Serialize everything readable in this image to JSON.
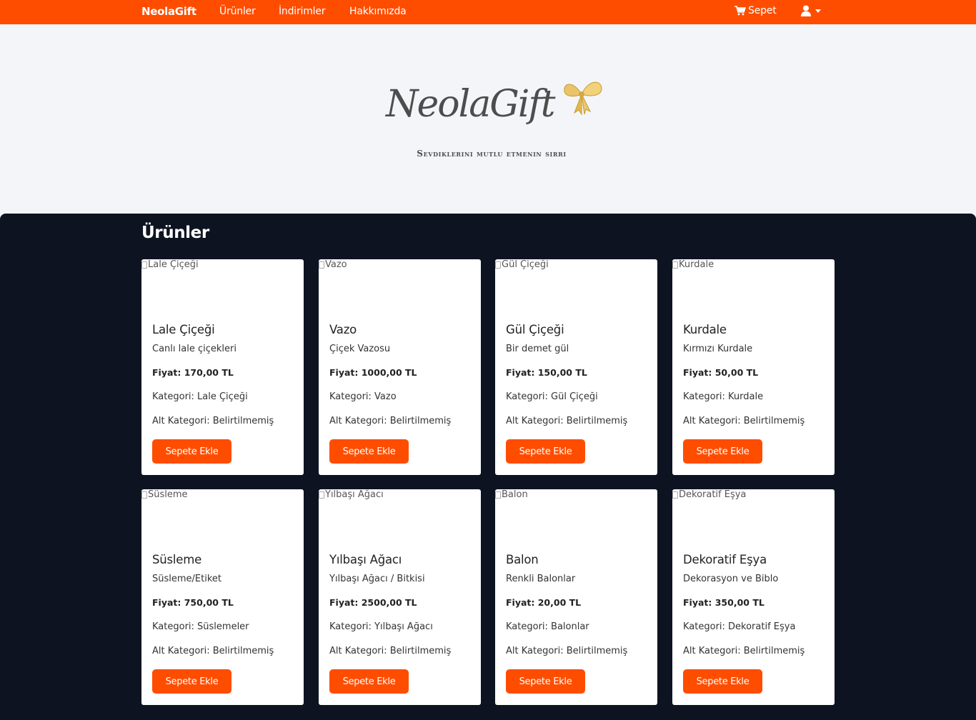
{
  "colors": {
    "brand": "#ff4d00",
    "panel": "#0e1321",
    "hero": "#f4f5f8"
  },
  "navbar": {
    "brand": "NeolaGift",
    "links": [
      "Ürünler",
      "İndirimler",
      "Hakkımızda"
    ],
    "cart_label": "Sepet",
    "cart_icon": "shopping-cart-icon",
    "user_icon": "user-icon"
  },
  "hero": {
    "logo_script": "NeolaGift",
    "tagline": "Sevdiklerini mutlu etmenin sırrı"
  },
  "products_section": {
    "title": "Ürünler",
    "add_to_cart_label": "Sepete Ekle",
    "items": [
      {
        "name": "Lale Çiçeği",
        "image_alt": "Lale Çiçeği",
        "description": "Canlı lale çiçekleri",
        "price_label": "Fiyat: 170,00 TL",
        "category_label": "Kategori: Lale Çiçeği",
        "subcategory_label": "Alt Kategori: Belirtilmemiş"
      },
      {
        "name": "Vazo",
        "image_alt": "Vazo",
        "description": "Çiçek Vazosu",
        "price_label": "Fiyat: 1000,00 TL",
        "category_label": "Kategori: Vazo",
        "subcategory_label": "Alt Kategori: Belirtilmemiş"
      },
      {
        "name": "Gül Çiçeği",
        "image_alt": "Gül Çiçeği",
        "description": "Bir demet gül",
        "price_label": "Fiyat: 150,00 TL",
        "category_label": "Kategori: Gül Çiçeği",
        "subcategory_label": "Alt Kategori: Belirtilmemiş"
      },
      {
        "name": "Kurdale",
        "image_alt": "Kurdale",
        "description": "Kırmızı Kurdale",
        "price_label": "Fiyat: 50,00 TL",
        "category_label": "Kategori: Kurdale",
        "subcategory_label": "Alt Kategori: Belirtilmemiş"
      },
      {
        "name": "Süsleme",
        "image_alt": "Süsleme",
        "description": "Süsleme/Etiket",
        "price_label": "Fiyat: 750,00 TL",
        "category_label": "Kategori: Süslemeler",
        "subcategory_label": "Alt Kategori: Belirtilmemiş"
      },
      {
        "name": "Yılbaşı Ağacı",
        "image_alt": "Yılbaşı Ağacı",
        "description": "Yılbaşı Ağacı / Bitkisi",
        "price_label": "Fiyat: 2500,00 TL",
        "category_label": "Kategori: Yılbaşı Ağacı",
        "subcategory_label": "Alt Kategori: Belirtilmemiş"
      },
      {
        "name": "Balon",
        "image_alt": "Balon",
        "description": "Renkli Balonlar",
        "price_label": "Fiyat: 20,00 TL",
        "category_label": "Kategori: Balonlar",
        "subcategory_label": "Alt Kategori: Belirtilmemiş"
      },
      {
        "name": "Dekoratif Eşya",
        "image_alt": "Dekoratif Eşya",
        "description": "Dekorasyon ve Biblo",
        "price_label": "Fiyat: 350,00 TL",
        "category_label": "Kategori: Dekoratif Eşya",
        "subcategory_label": "Alt Kategori: Belirtilmemiş"
      }
    ]
  }
}
